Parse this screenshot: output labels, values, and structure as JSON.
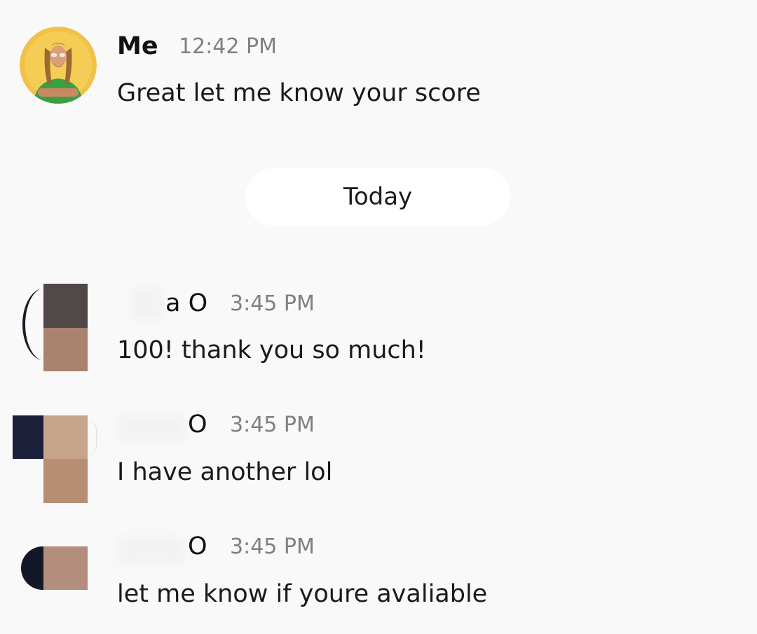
{
  "messages": [
    {
      "sender": "Me",
      "time": "12:42 PM",
      "text": "Great let me know your score"
    },
    {
      "sender": "a O",
      "time": "3:45 PM",
      "text": "100! thank you so much!"
    },
    {
      "sender": "O",
      "time": "3:45 PM",
      "text": "I have another lol"
    },
    {
      "sender": "O",
      "time": "3:45 PM",
      "text": "let me know if youre avaliable"
    }
  ],
  "date_divider": "Today",
  "colors": {
    "background": "#f9f9f9",
    "time_text": "#808080",
    "pill_background": "#ffffff"
  }
}
